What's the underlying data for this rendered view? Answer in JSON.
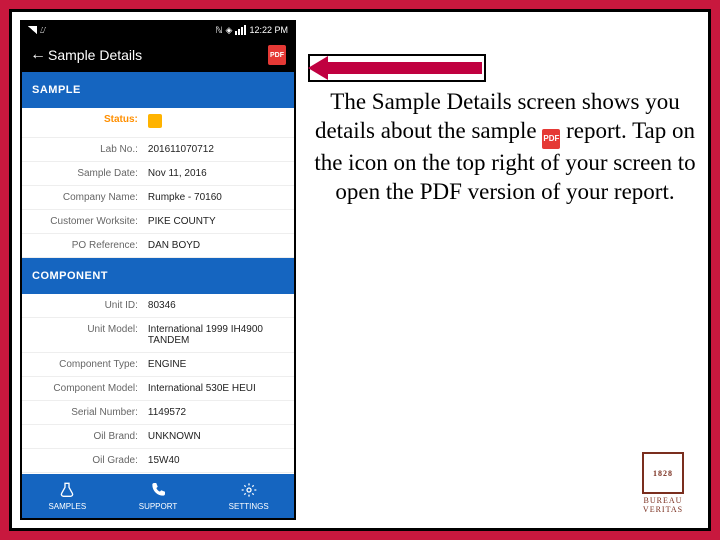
{
  "status_bar": {
    "time": "12:22 PM"
  },
  "app": {
    "screen_title": "Sample Details",
    "pdf_icon_label": "PDF"
  },
  "sample_section": {
    "header": "SAMPLE",
    "rows": {
      "status_label": "Status:",
      "lab_no_label": "Lab No.:",
      "lab_no_value": "201611070712",
      "sample_date_label": "Sample Date:",
      "sample_date_value": "Nov 11, 2016",
      "company_label": "Company Name:",
      "company_value": "Rumpke - 70160",
      "worksite_label": "Customer Worksite:",
      "worksite_value": "PIKE COUNTY",
      "po_label": "PO Reference:",
      "po_value": "DAN BOYD"
    }
  },
  "component_section": {
    "header": "COMPONENT",
    "rows": {
      "unit_id_label": "Unit ID:",
      "unit_id_value": "80346",
      "unit_model_label": "Unit Model:",
      "unit_model_value": "International 1999 IH4900 TANDEM",
      "comp_type_label": "Component Type:",
      "comp_type_value": "ENGINE",
      "comp_model_label": "Component Model:",
      "comp_model_value": "International 530E HEUI",
      "serial_label": "Serial Number:",
      "serial_value": "1149572",
      "oil_brand_label": "Oil Brand:",
      "oil_brand_value": "UNKNOWN",
      "oil_grade_label": "Oil Grade:",
      "oil_grade_value": "15W40"
    }
  },
  "tabs": {
    "samples": "SAMPLES",
    "support": "SUPPORT",
    "settings": "SETTINGS"
  },
  "callout": {
    "text_1": "The Sample Details screen shows you details about the sample ",
    "text_2": "report.  Tap on the icon on the top right of your screen to open the PDF version of your report."
  },
  "logo": {
    "line1": "BUREAU",
    "line2": "VERITAS",
    "year": "1828"
  }
}
